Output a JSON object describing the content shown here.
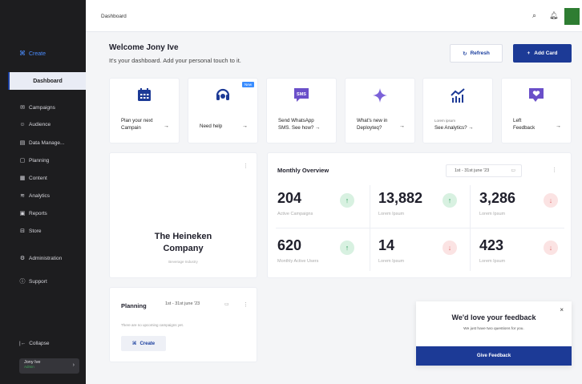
{
  "sidebar": {
    "create_label": "Create",
    "active_item": "Dashboard",
    "items": [
      {
        "icon": "campaigns-icon",
        "label": "Campaigns"
      },
      {
        "icon": "audience-icon",
        "label": "Audience"
      },
      {
        "icon": "database-icon",
        "label": "Data Manage..."
      },
      {
        "icon": "planning-icon",
        "label": "Planning"
      },
      {
        "icon": "content-icon",
        "label": "Content"
      },
      {
        "icon": "analytics-icon",
        "label": "Analytics"
      },
      {
        "icon": "reports-icon",
        "label": "Reports"
      },
      {
        "icon": "store-icon",
        "label": "Store"
      },
      {
        "icon": "administration-icon",
        "label": "Administration"
      },
      {
        "icon": "support-icon",
        "label": "Support"
      }
    ],
    "collapse_label": "Collapse",
    "user": {
      "name": "Jony Ive",
      "role": "Admin"
    }
  },
  "header": {
    "title": "Dashboard"
  },
  "welcome": {
    "title": "Welcome Jony Ive",
    "subtitle": "It's your dashboard. Add your personal touch to it."
  },
  "actions": {
    "refresh_label": "Refresh",
    "add_card_label": "Add Card"
  },
  "quick_cards": [
    {
      "icon": "calendar-icon",
      "line1": "Plan your next",
      "line2": "Campain"
    },
    {
      "icon": "headset-icon",
      "line1": "Need help",
      "line2": "",
      "badge": "New"
    },
    {
      "icon": "sms-icon",
      "icon_text": "SMS",
      "line1": "Send WhatsApp",
      "line2": "SMS. See how? →"
    },
    {
      "icon": "sparkle-icon",
      "line1": "What's new in",
      "line2": "Deployteq?"
    },
    {
      "icon": "analytics-chart-icon",
      "small": "Lorem ipsum",
      "line1": "See Analytics? →",
      "line2": ""
    },
    {
      "icon": "feedback-icon",
      "line1": "Left",
      "line2": "Feedback"
    }
  ],
  "company": {
    "name_line1": "The Heineken",
    "name_line2": "Company",
    "industry": "Beverage Industry"
  },
  "overview": {
    "title": "Monthly Overview",
    "date_range": "1st - 31st june '23",
    "stats": [
      {
        "value": "204",
        "label": "Active Campaigns",
        "trend": "up"
      },
      {
        "value": "13,882",
        "label": "Lorem Ipsum",
        "trend": "up"
      },
      {
        "value": "3,286",
        "label": "Lorem Ipsum",
        "trend": "down"
      },
      {
        "value": "620",
        "label": "Monthly Active Users",
        "trend": "up"
      },
      {
        "value": "14",
        "label": "Lorem Ipsum",
        "trend": "down"
      },
      {
        "value": "423",
        "label": "Lorem Ipsum",
        "trend": "down"
      }
    ]
  },
  "planning": {
    "title": "Planning",
    "date_range": "1st - 31st june '23",
    "empty_text": "There are no upcoming campaigns yet.",
    "create_label": "Create"
  },
  "feedback": {
    "title": "We'd love your feedback",
    "subtitle": "We just have two questions for you.",
    "button_label": "Give Feedback"
  },
  "colors": {
    "primary": "#1c3a96",
    "sidebar_bg": "#1d1d1f",
    "positive": "#2c9d59",
    "negative": "#e07575",
    "accent_blue": "#3a8dff"
  }
}
